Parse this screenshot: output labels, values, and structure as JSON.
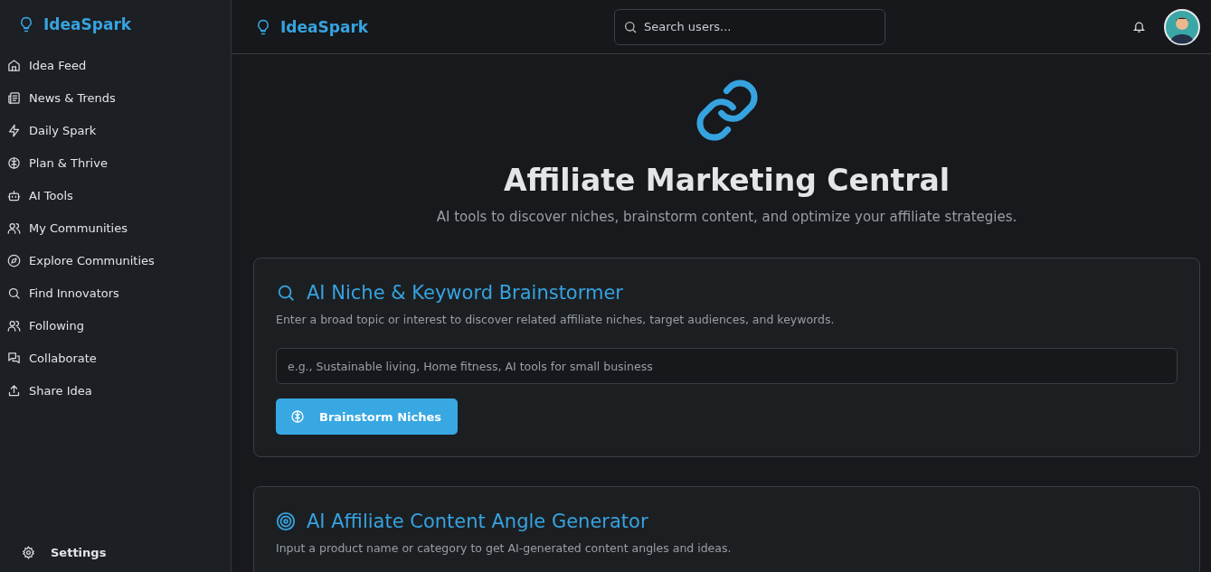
{
  "sidebar": {
    "brand": "IdeaSpark",
    "items": [
      {
        "label": "Idea Feed",
        "kind": "home"
      },
      {
        "label": "News & Trends",
        "kind": "news"
      },
      {
        "label": "Daily Spark",
        "kind": "bolt"
      },
      {
        "label": "Plan & Thrive",
        "kind": "brain"
      },
      {
        "label": "AI Tools",
        "kind": "bot"
      },
      {
        "label": "My Communities",
        "kind": "users"
      },
      {
        "label": "Explore Communities",
        "kind": "compass"
      },
      {
        "label": "Find Innovators",
        "kind": "search"
      },
      {
        "label": "Following",
        "kind": "users"
      },
      {
        "label": "Collaborate",
        "kind": "chat"
      },
      {
        "label": "Share Idea",
        "kind": "upload"
      }
    ],
    "settings": "Settings"
  },
  "header": {
    "brand": "IdeaSpark",
    "search": {
      "placeholder": "Search users..."
    }
  },
  "hero": {
    "title": "Affiliate Marketing Central",
    "subtitle": "AI tools to discover niches, brainstorm content, and optimize your affiliate strategies."
  },
  "sections": [
    {
      "kind": "search",
      "title": "AI Niche & Keyword Brainstormer",
      "description": "Enter a broad topic or interest to discover related affiliate niches, target audiences, and keywords.",
      "input": {
        "placeholder": "e.g., Sustainable living, Home fitness, AI tools for small business"
      },
      "button": "Brainstorm Niches"
    },
    {
      "kind": "target",
      "title": "AI Affiliate Content Angle Generator",
      "description": "Input a product name or category to get AI-generated content angles and ideas."
    }
  ]
}
